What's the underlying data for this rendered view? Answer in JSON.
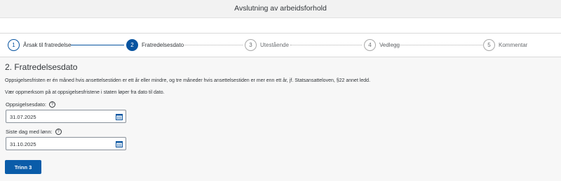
{
  "header": {
    "title": "Avslutning av arbeidsforhold"
  },
  "wizard": {
    "steps": [
      {
        "number": "1",
        "label": "Årsak til fratredelse"
      },
      {
        "number": "2",
        "label": "Fratredelsesdato"
      },
      {
        "number": "3",
        "label": "Utestående"
      },
      {
        "number": "4",
        "label": "Vedlegg"
      },
      {
        "number": "5",
        "label": "Kommentar"
      }
    ],
    "active_step": 2
  },
  "form": {
    "section_title": "2. Fratredelsesdato",
    "info_1": "Oppsigelsesfristen er én måned hvis ansettelsestiden er ett år eller mindre, og tre måneder hvis ansettelsestiden er mer enn ett år, jf. Statsansatteloven, §22 annet ledd.",
    "info_2": "Vær oppmerksom på at oppsigelsesfristene i staten løper fra dato til dato.",
    "termination_date": {
      "label": "Oppsigelsesdato:",
      "value": "31.07.2025",
      "help_icon": "help-circle-icon",
      "calendar_icon": "calendar-icon"
    },
    "last_paid_day": {
      "label": "Siste dag med lønn:",
      "value": "31.10.2025",
      "help_icon": "help-circle-icon",
      "calendar_icon": "calendar-icon"
    },
    "next_button": "Trinn 3"
  },
  "colors": {
    "accent": "#0854a0",
    "button": "#0a5ca9"
  }
}
